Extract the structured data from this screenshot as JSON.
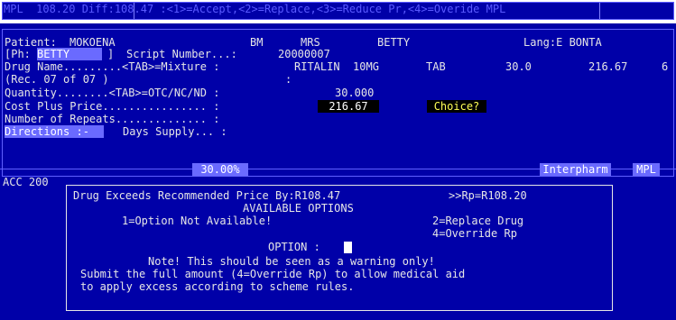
{
  "topbar": {
    "text": "MPL  108.20 Diff:108.47 :<1>=Accept,<2>=Replace,<3>=Reduce Pr,<4>=Overide MPL"
  },
  "patient": {
    "label": "Patient:",
    "surname": "MOKOENA",
    "initials": "BM",
    "title": "MRS",
    "firstname": "BETTY",
    "lang": "Lang:E BONTA"
  },
  "ph": {
    "prefix": "[Ph:",
    "value": "BETTY",
    "suffix": "]",
    "script_label": "Script Number...:",
    "script_number": "20000007"
  },
  "drug": {
    "label": "Drug Name.........<TAB>=Mixture :",
    "name": "RITALIN  10MG",
    "form": "TAB",
    "qty": "30.0",
    "price": "216.67",
    "extra": "6"
  },
  "rec": {
    "text": "(Rec. 07 of 07 )",
    "colon": ":"
  },
  "quantity": {
    "label": "Quantity........<TAB>=OTC/NC/ND :",
    "value": "30.000"
  },
  "cost": {
    "label": "Cost Plus Price................ :",
    "value": "216.67",
    "choice": "Choice?"
  },
  "repeats": {
    "label": "Number of Repeats.............. :"
  },
  "directions": {
    "button": "Directions :-",
    "supply_label": "Days Supply... :"
  },
  "bottom_bar": {
    "percent": "30.00%",
    "supplier": "Interpharm",
    "mpl": "MPL",
    "acc": "ACC 200"
  },
  "dialog": {
    "line1": "Drug Exceeds Recommended Price By:R108.47",
    "line1_right": ">>Rp=R108.20",
    "header": "AVAILABLE OPTIONS",
    "opt1": "1=Option Not Available!",
    "opt2": "2=Replace Drug",
    "opt4": "4=Override Rp",
    "option_label": "OPTION :",
    "note": "Note! This should be seen as a warning only!",
    "submit1": "Submit the full amount (4=Override Rp) to allow medical aid",
    "submit2": "to apply excess according to scheme rules."
  },
  "colors": {
    "background": "#0000a8",
    "highlight": "#6a6aff",
    "text": "#e6e6e6",
    "accent_yellow": "#ffff55"
  }
}
